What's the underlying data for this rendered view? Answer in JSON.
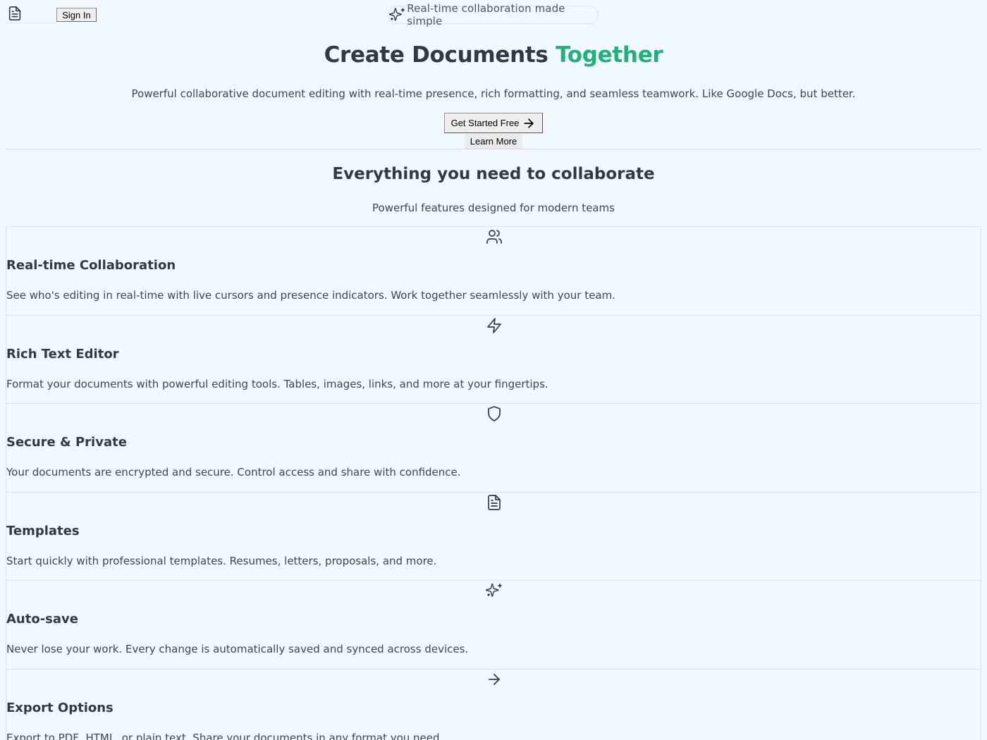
{
  "header": {
    "logo_icon": "document-icon",
    "signin_label": "Sign In",
    "badge_icon": "sparkles-icon",
    "badge_text": "Real-time collaboration made simple"
  },
  "hero": {
    "title_main": "Create Documents",
    "title_accent": "Together",
    "accent_color": "#22b07a",
    "subtitle": "Powerful collaborative document editing with real-time presence, rich formatting, and seamless teamwork. Like Google Docs, but better.",
    "cta_primary": "Get Started Free",
    "cta_primary_icon": "arrow-right-icon",
    "cta_secondary": "Learn More"
  },
  "features_section": {
    "heading": "Everything you need to collaborate",
    "subheading": "Powerful features designed for modern teams",
    "items": [
      {
        "icon": "users-icon",
        "title": "Real-time Collaboration",
        "description": "See who's editing in real-time with live cursors and presence indicators. Work together seamlessly with your team."
      },
      {
        "icon": "zap-icon",
        "title": "Rich Text Editor",
        "description": "Format your documents with powerful editing tools. Tables, images, links, and more at your fingertips."
      },
      {
        "icon": "shield-icon",
        "title": "Secure & Private",
        "description": "Your documents are encrypted and secure. Control access and share with confidence."
      },
      {
        "icon": "document-icon",
        "title": "Templates",
        "description": "Start quickly with professional templates. Resumes, letters, proposals, and more."
      },
      {
        "icon": "sparkles-icon",
        "title": "Auto-save",
        "description": "Never lose your work. Every change is automatically saved and synced across devices."
      },
      {
        "icon": "arrow-right-icon",
        "title": "Export Options",
        "description": "Export to PDF, HTML, or plain text. Share your documents in any format you need."
      }
    ]
  }
}
